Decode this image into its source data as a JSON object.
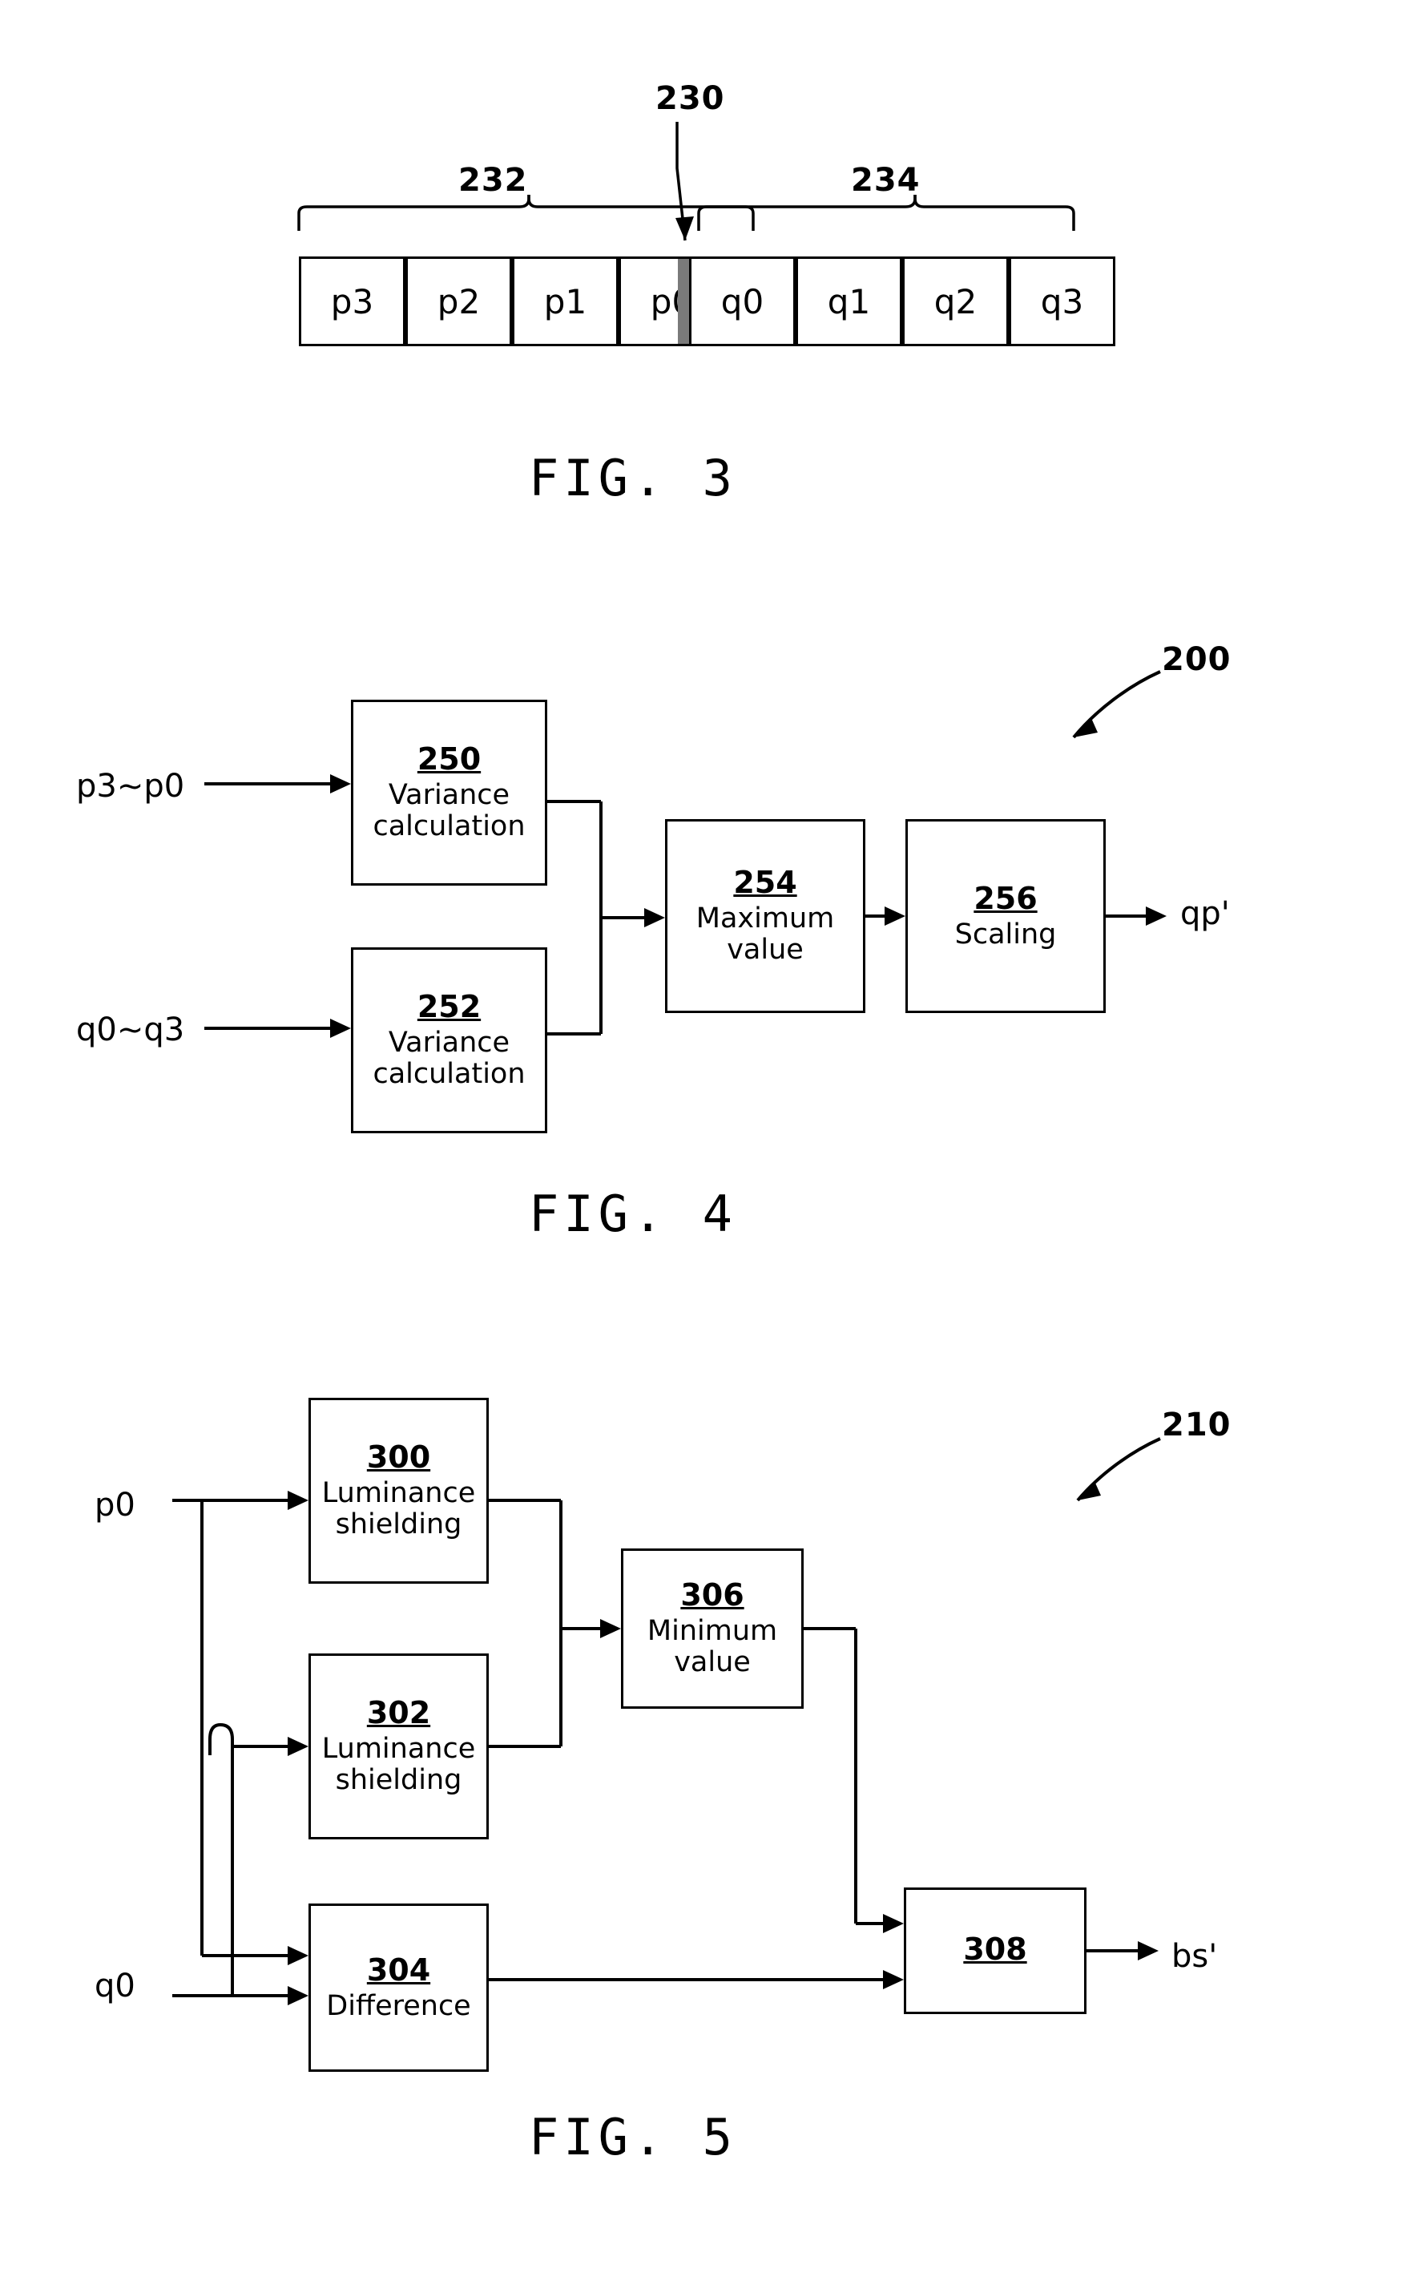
{
  "figures": [
    {
      "id": "fig3",
      "label": "FIG. 3",
      "refs": {
        "top": "230",
        "left_group": "232",
        "right_group": "234"
      },
      "cells": [
        "p3",
        "p2",
        "p1",
        "p0",
        "q0",
        "q1",
        "q2",
        "q3"
      ]
    },
    {
      "id": "fig4",
      "label": "FIG. 4",
      "system_ref": "200",
      "inputs": [
        "p3~p0",
        "q0~q3"
      ],
      "outputs": [
        "qp'"
      ],
      "blocks": [
        {
          "num": "250",
          "cap": "Variance\ncalculation"
        },
        {
          "num": "252",
          "cap": "Variance\ncalculation"
        },
        {
          "num": "254",
          "cap": "Maximum\nvalue"
        },
        {
          "num": "256",
          "cap": "Scaling"
        }
      ]
    },
    {
      "id": "fig5",
      "label": "FIG. 5",
      "system_ref": "210",
      "inputs": [
        "p0",
        "q0"
      ],
      "outputs": [
        "bs'"
      ],
      "blocks": [
        {
          "num": "300",
          "cap": "Luminance\nshielding"
        },
        {
          "num": "302",
          "cap": "Luminance\nshielding"
        },
        {
          "num": "304",
          "cap": "Difference"
        },
        {
          "num": "306",
          "cap": "Minimum\nvalue"
        },
        {
          "num": "308",
          "cap": ""
        }
      ]
    }
  ]
}
